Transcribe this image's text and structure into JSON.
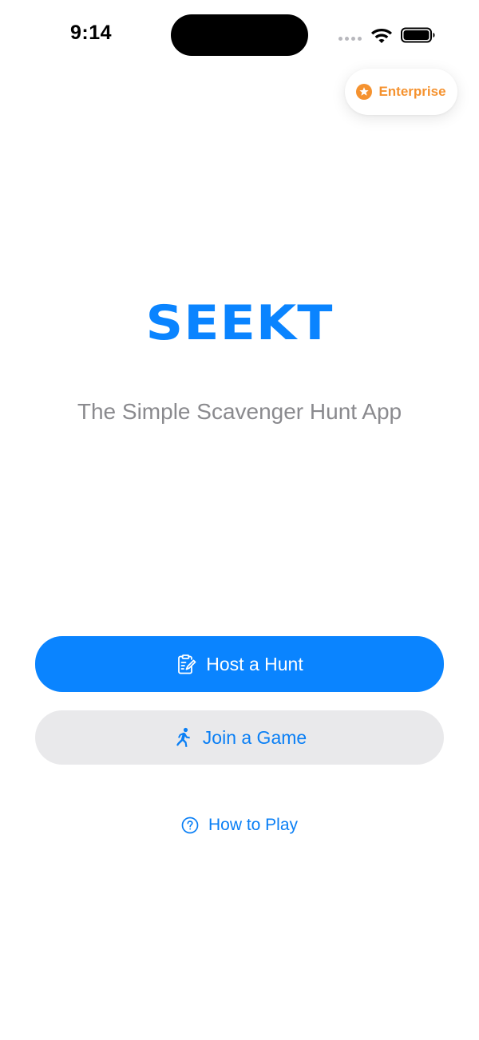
{
  "status_bar": {
    "time": "9:14"
  },
  "badge": {
    "label": "Enterprise",
    "icon": "star-circle-icon",
    "color": "#f5922f"
  },
  "hero": {
    "logo": "SEEKT",
    "tagline": "The Simple Scavenger Hunt App"
  },
  "actions": {
    "host": {
      "label": "Host a Hunt",
      "icon": "clipboard-edit-icon"
    },
    "join": {
      "label": "Join a Game",
      "icon": "running-person-icon"
    },
    "how_to_play": {
      "label": "How to Play",
      "icon": "question-circle-icon"
    }
  },
  "colors": {
    "accent": "#0a84ff",
    "secondary_button_bg": "#e9e9eb",
    "tagline": "#8a8a8e"
  }
}
